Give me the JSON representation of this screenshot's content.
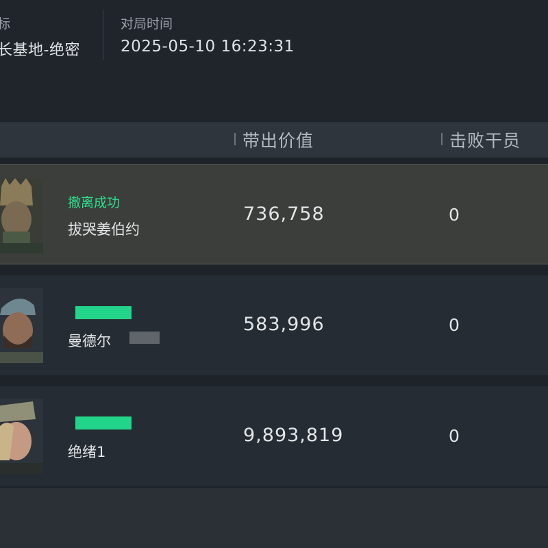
{
  "match": {
    "map_label": "标",
    "map_value": "长基地-绝密",
    "time_label": "对局时间",
    "time_value": "2025-05-10 16:23:31"
  },
  "table": {
    "columns": [
      "带出价值",
      "击败干员"
    ]
  },
  "rows": [
    {
      "status": "撤离成功",
      "name": "拔哭姜伯约",
      "value": "736,758",
      "kills": "0",
      "highlight": true
    },
    {
      "status": "",
      "name": "曼德尔",
      "value": "583,996",
      "kills": "0",
      "highlight": false
    },
    {
      "status": "",
      "name": "绝绪1",
      "value": "9,893,819",
      "kills": "0",
      "highlight": false
    }
  ],
  "colors": {
    "background": "#1e2329",
    "header": "#2e353c",
    "highlight_row": "#3b3e3a",
    "status_green": "#2fe08f"
  }
}
